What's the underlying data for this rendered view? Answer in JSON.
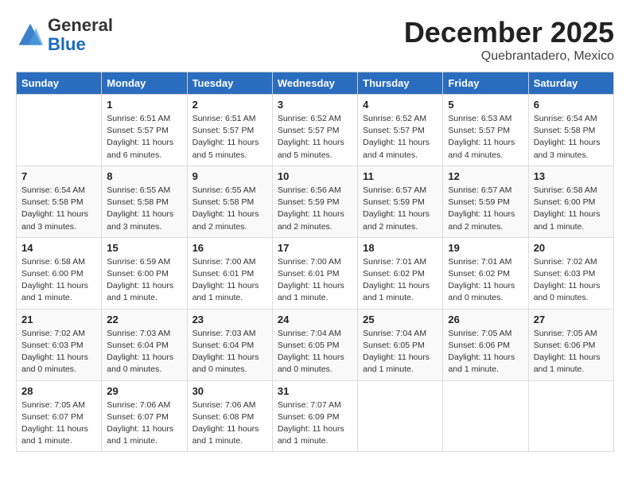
{
  "header": {
    "logo_line1": "General",
    "logo_line2": "Blue",
    "main_title": "December 2025",
    "subtitle": "Quebrantadero, Mexico"
  },
  "days_of_week": [
    "Sunday",
    "Monday",
    "Tuesday",
    "Wednesday",
    "Thursday",
    "Friday",
    "Saturday"
  ],
  "weeks": [
    [
      {
        "day": "",
        "info": ""
      },
      {
        "day": "1",
        "info": "Sunrise: 6:51 AM\nSunset: 5:57 PM\nDaylight: 11 hours\nand 6 minutes."
      },
      {
        "day": "2",
        "info": "Sunrise: 6:51 AM\nSunset: 5:57 PM\nDaylight: 11 hours\nand 5 minutes."
      },
      {
        "day": "3",
        "info": "Sunrise: 6:52 AM\nSunset: 5:57 PM\nDaylight: 11 hours\nand 5 minutes."
      },
      {
        "day": "4",
        "info": "Sunrise: 6:52 AM\nSunset: 5:57 PM\nDaylight: 11 hours\nand 4 minutes."
      },
      {
        "day": "5",
        "info": "Sunrise: 6:53 AM\nSunset: 5:57 PM\nDaylight: 11 hours\nand 4 minutes."
      },
      {
        "day": "6",
        "info": "Sunrise: 6:54 AM\nSunset: 5:58 PM\nDaylight: 11 hours\nand 3 minutes."
      }
    ],
    [
      {
        "day": "7",
        "info": "Sunrise: 6:54 AM\nSunset: 5:58 PM\nDaylight: 11 hours\nand 3 minutes."
      },
      {
        "day": "8",
        "info": "Sunrise: 6:55 AM\nSunset: 5:58 PM\nDaylight: 11 hours\nand 3 minutes."
      },
      {
        "day": "9",
        "info": "Sunrise: 6:55 AM\nSunset: 5:58 PM\nDaylight: 11 hours\nand 2 minutes."
      },
      {
        "day": "10",
        "info": "Sunrise: 6:56 AM\nSunset: 5:59 PM\nDaylight: 11 hours\nand 2 minutes."
      },
      {
        "day": "11",
        "info": "Sunrise: 6:57 AM\nSunset: 5:59 PM\nDaylight: 11 hours\nand 2 minutes."
      },
      {
        "day": "12",
        "info": "Sunrise: 6:57 AM\nSunset: 5:59 PM\nDaylight: 11 hours\nand 2 minutes."
      },
      {
        "day": "13",
        "info": "Sunrise: 6:58 AM\nSunset: 6:00 PM\nDaylight: 11 hours\nand 1 minute."
      }
    ],
    [
      {
        "day": "14",
        "info": "Sunrise: 6:58 AM\nSunset: 6:00 PM\nDaylight: 11 hours\nand 1 minute."
      },
      {
        "day": "15",
        "info": "Sunrise: 6:59 AM\nSunset: 6:00 PM\nDaylight: 11 hours\nand 1 minute."
      },
      {
        "day": "16",
        "info": "Sunrise: 7:00 AM\nSunset: 6:01 PM\nDaylight: 11 hours\nand 1 minute."
      },
      {
        "day": "17",
        "info": "Sunrise: 7:00 AM\nSunset: 6:01 PM\nDaylight: 11 hours\nand 1 minute."
      },
      {
        "day": "18",
        "info": "Sunrise: 7:01 AM\nSunset: 6:02 PM\nDaylight: 11 hours\nand 1 minute."
      },
      {
        "day": "19",
        "info": "Sunrise: 7:01 AM\nSunset: 6:02 PM\nDaylight: 11 hours\nand 0 minutes."
      },
      {
        "day": "20",
        "info": "Sunrise: 7:02 AM\nSunset: 6:03 PM\nDaylight: 11 hours\nand 0 minutes."
      }
    ],
    [
      {
        "day": "21",
        "info": "Sunrise: 7:02 AM\nSunset: 6:03 PM\nDaylight: 11 hours\nand 0 minutes."
      },
      {
        "day": "22",
        "info": "Sunrise: 7:03 AM\nSunset: 6:04 PM\nDaylight: 11 hours\nand 0 minutes."
      },
      {
        "day": "23",
        "info": "Sunrise: 7:03 AM\nSunset: 6:04 PM\nDaylight: 11 hours\nand 0 minutes."
      },
      {
        "day": "24",
        "info": "Sunrise: 7:04 AM\nSunset: 6:05 PM\nDaylight: 11 hours\nand 0 minutes."
      },
      {
        "day": "25",
        "info": "Sunrise: 7:04 AM\nSunset: 6:05 PM\nDaylight: 11 hours\nand 1 minute."
      },
      {
        "day": "26",
        "info": "Sunrise: 7:05 AM\nSunset: 6:06 PM\nDaylight: 11 hours\nand 1 minute."
      },
      {
        "day": "27",
        "info": "Sunrise: 7:05 AM\nSunset: 6:06 PM\nDaylight: 11 hours\nand 1 minute."
      }
    ],
    [
      {
        "day": "28",
        "info": "Sunrise: 7:05 AM\nSunset: 6:07 PM\nDaylight: 11 hours\nand 1 minute."
      },
      {
        "day": "29",
        "info": "Sunrise: 7:06 AM\nSunset: 6:07 PM\nDaylight: 11 hours\nand 1 minute."
      },
      {
        "day": "30",
        "info": "Sunrise: 7:06 AM\nSunset: 6:08 PM\nDaylight: 11 hours\nand 1 minute."
      },
      {
        "day": "31",
        "info": "Sunrise: 7:07 AM\nSunset: 6:09 PM\nDaylight: 11 hours\nand 1 minute."
      },
      {
        "day": "",
        "info": ""
      },
      {
        "day": "",
        "info": ""
      },
      {
        "day": "",
        "info": ""
      }
    ]
  ]
}
